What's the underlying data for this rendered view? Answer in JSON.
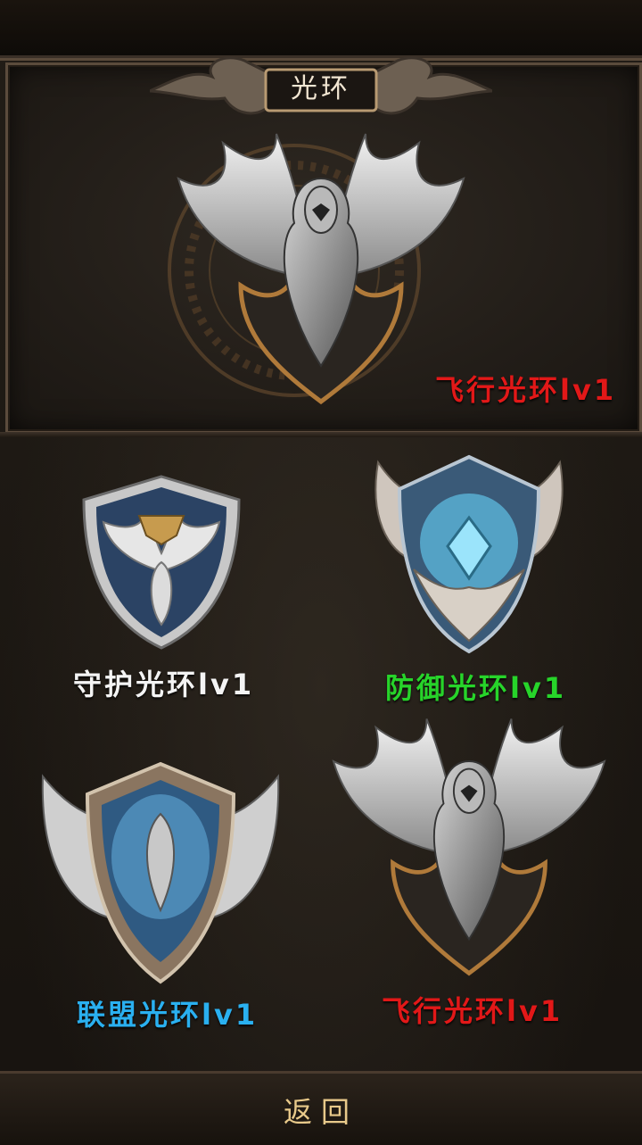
{
  "header": {
    "title": "光环"
  },
  "preview": {
    "emblem_icon": "winged-eagle-emblem-icon",
    "label": "飞行光环lv1",
    "label_color": "#e21818"
  },
  "auras": [
    {
      "label": "守护光环lv1",
      "icon": "eagle-shield-icon",
      "color": "#f4f4f4"
    },
    {
      "label": "防御光环lv1",
      "icon": "winged-blue-shield-icon",
      "color": "#27d42a"
    },
    {
      "label": "联盟光环lv1",
      "icon": "winged-crest-shield-icon",
      "color": "#2ab0f0"
    },
    {
      "label": "飞行光环lv1",
      "icon": "winged-eagle-emblem-icon",
      "color": "#e21818"
    }
  ],
  "footer": {
    "back_label": "返回"
  }
}
